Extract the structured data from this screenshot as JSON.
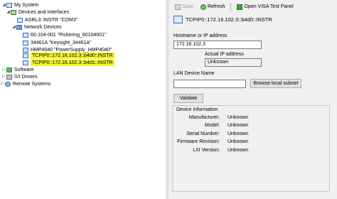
{
  "tree": {
    "my_system": "My System",
    "devices_and_interfaces": "Devices and Interfaces",
    "asrl3": "ASRL3::INSTR \"COM3\"",
    "network_devices": "Network Devices",
    "dev1": "60-104-001 \"Pickering_60104001\"",
    "dev2": "34461A \"Keysight_34461A\"",
    "dev3": "HMP4040 \"PowerSupply_HMP4040\"",
    "dev4": "TCPIP0::172.16.102.3::b4d0::INSTR",
    "dev5": "TCPIP0::172.16.102.3::b4d1::INSTR",
    "software": "Software",
    "ivi_drivers": "IVI Drivers",
    "remote_systems": "Remote Systems"
  },
  "toolbar": {
    "save": "Save",
    "refresh": "Refresh",
    "visa_panel": "Open VISA Test Panel"
  },
  "detail": {
    "resource_name": "TCPIP0::172.16.102.3::b4d0::INSTR",
    "hostname_label": "Hostname or IP address",
    "hostname_value": "172.16.102.3",
    "actual_ip_label": "Actual IP address",
    "actual_ip_value": "Unknown",
    "lan_name_label": "LAN Device Name",
    "lan_name_value": "",
    "browse_button": "Browse local subnet",
    "validate_button": "Validate",
    "device_info_title": "Device Information",
    "manufacturer_label": "Manufacturer:",
    "manufacturer_value": "Unknown",
    "model_label": "Model:",
    "model_value": "Unknown",
    "serial_label": "Serial Number:",
    "serial_value": "Unknown",
    "firmware_label": "Firmware Revision:",
    "firmware_value": "Unknown",
    "lxi_label": "LXI Version:",
    "lxi_value": "Unknown"
  },
  "colors": {
    "highlight": "#f4f52c",
    "pane_bg": "#f0f0f0"
  }
}
